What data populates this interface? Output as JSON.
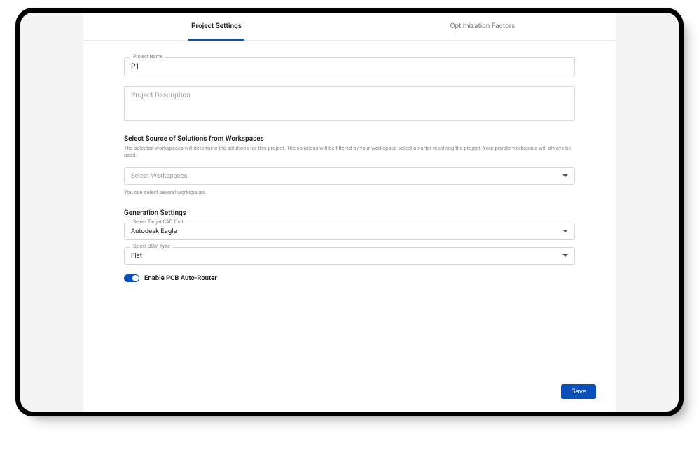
{
  "tabs": {
    "project_settings": "Project Settings",
    "optimization_factors": "Optimization Factors"
  },
  "project_name": {
    "label": "Project Name",
    "value": "P1"
  },
  "project_description": {
    "placeholder": "Project Description",
    "value": ""
  },
  "workspaces_section": {
    "heading": "Select Source of Solutions from Workspaces",
    "sub": "The selected workspaces will determine the solutions for this project. The solutions will be filtered by your workspace selection after resolving the project. Your private workspace will always be used.",
    "select_placeholder": "Select Workspaces",
    "helper": "You can select several workspaces."
  },
  "generation_section": {
    "heading": "Generation Settings",
    "cad_tool": {
      "label": "Select Target CAD Tool",
      "value": "Autodesk Eagle"
    },
    "bom_type": {
      "label": "Select BOM Type",
      "value": "Flat"
    }
  },
  "auto_router": {
    "label": "Enable PCB Auto-Router",
    "enabled": true
  },
  "footer": {
    "save_label": "Save"
  }
}
